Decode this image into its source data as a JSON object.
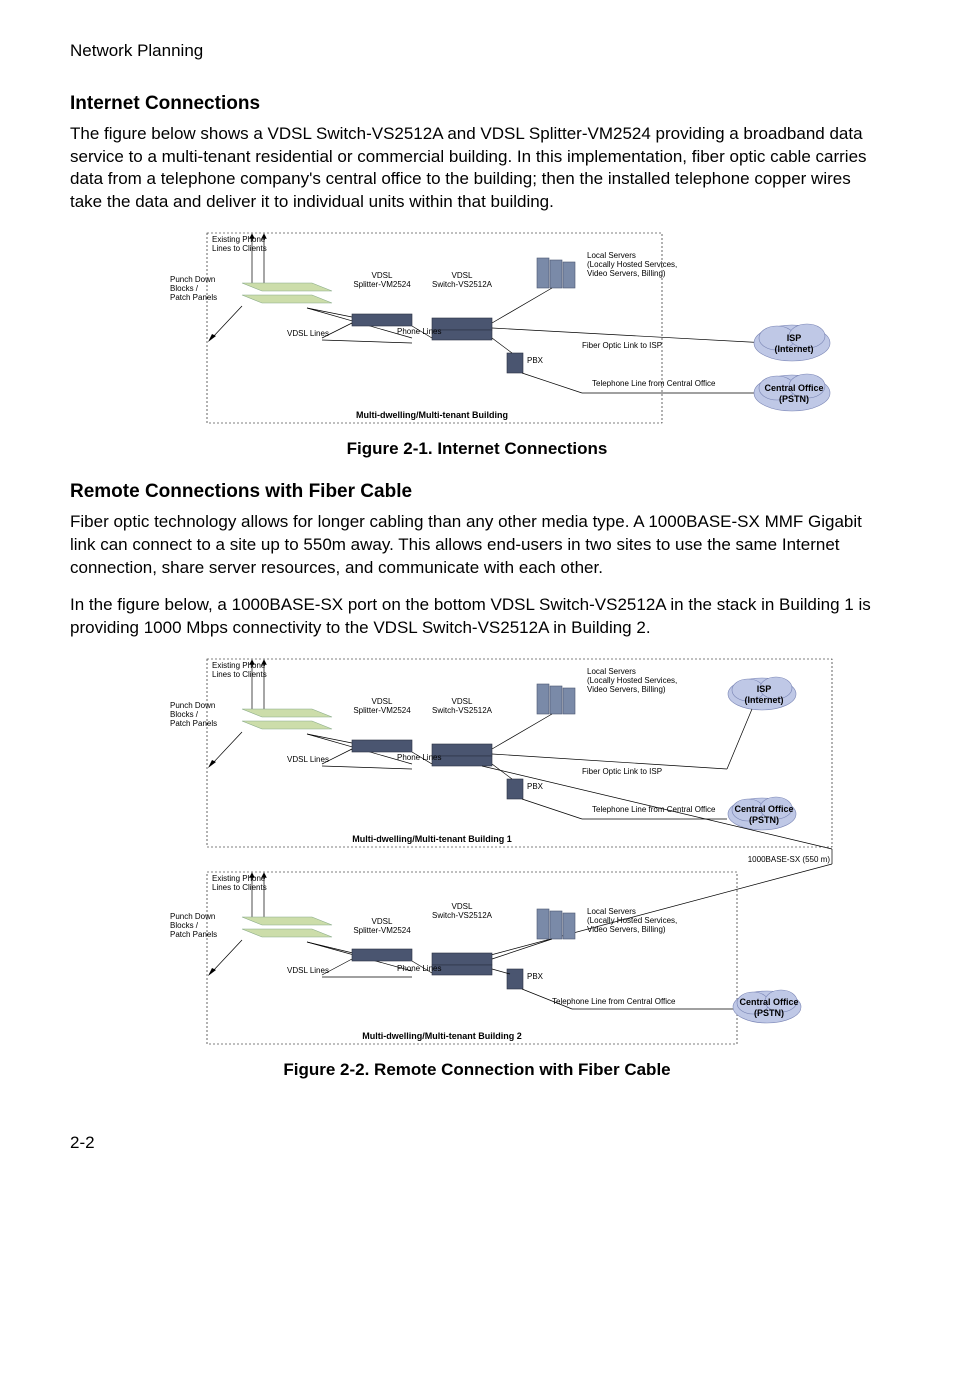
{
  "header": {
    "section": "Network Planning"
  },
  "s1": {
    "heading": "Internet Connections",
    "para": "The figure below shows a VDSL Switch-VS2512A and VDSL Splitter-VM2524 providing a broadband data service to a multi-tenant residential or commercial building. In this implementation, fiber optic cable carries data from a telephone company's central office to the building; then the installed telephone copper wires take the data and deliver it to individual units within that building."
  },
  "s2": {
    "heading": "Remote Connections with Fiber Cable",
    "para1": "Fiber optic technology allows for longer cabling than any other media type. A 1000BASE-SX MMF Gigabit link can connect to a site up to 550m away. This allows end-users in two sites to use the same Internet connection, share server resources, and communicate with each other.",
    "para2": "In the figure below, a 1000BASE-SX port on the bottom VDSL Switch-VS2512A in the stack in Building 1 is providing 1000 Mbps connectivity to the VDSL Switch-VS2512A in Building 2."
  },
  "fig1": {
    "caption": "Figure 2-1.  Internet Connections",
    "labels": {
      "existing": "Existing Phone",
      "existing2": "Lines to Clients",
      "punch1": "Punch Down",
      "punch2": "Blocks /",
      "punch3": "Patch Panels",
      "splitter1": "VDSL",
      "splitter2": "Splitter-VM2524",
      "switch1": "VDSL",
      "switch2": "Switch-VS2512A",
      "vdsllines": "VDSL Lines",
      "phonelines": "Phone Lines",
      "pbx": "PBX",
      "localsrv1": "Local Servers",
      "localsrv2": "(Locally Hosted Services,",
      "localsrv3": "Video Servers, Billing)",
      "fiberlink": "Fiber Optic Link to ISP",
      "tellink": "Telephone Line from Central Office",
      "isp1": "ISP",
      "isp2": "(Internet)",
      "co1": "Central Office",
      "co2": "(PSTN)",
      "building": "Multi-dwelling/Multi-tenant Building"
    }
  },
  "fig2": {
    "caption": "Figure 2-2.  Remote Connection with Fiber Cable",
    "labels": {
      "link1000": "1000BASE-SX (550 m)",
      "building1": "Multi-dwelling/Multi-tenant Building 1",
      "building2": "Multi-dwelling/Multi-tenant Building 2"
    }
  },
  "pagenum": "2-2"
}
